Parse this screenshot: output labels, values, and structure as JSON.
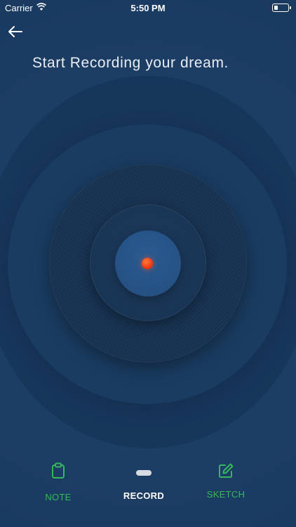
{
  "status_bar": {
    "carrier": "Carrier",
    "time": "5:50 PM"
  },
  "header": {
    "title": "Start Recording your dream."
  },
  "recorder": {
    "state": "idle",
    "dot_color": "#f23b12"
  },
  "tabs": [
    {
      "label": "NOTE",
      "icon": "clipboard-icon",
      "color": "#34b85a",
      "active": false
    },
    {
      "label": "RECORD",
      "icon": "recorder-icon",
      "color": "#ffffff",
      "active": true
    },
    {
      "label": "SKETCH",
      "icon": "edit-icon",
      "color": "#34b85a",
      "active": false
    }
  ],
  "colors": {
    "background": "#1d3f66",
    "accent_green": "#34b85a"
  }
}
